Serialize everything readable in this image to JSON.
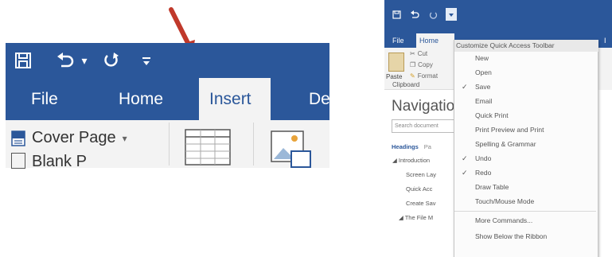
{
  "left": {
    "qat": {
      "save_icon": "save-icon",
      "undo_icon": "undo-icon",
      "undo_dropdown": "▾",
      "redo_icon": "redo-icon",
      "customize_icon": "customize-qat-icon"
    },
    "tabs": [
      "File",
      "Home",
      "Insert",
      "De"
    ],
    "active_tab": "Insert",
    "cover_page": "Cover Page",
    "cover_page_arrow": "▾",
    "blank_page_partial": "Blank P"
  },
  "right": {
    "tabs": [
      "File",
      "Home",
      "I"
    ],
    "ribbon": {
      "paste": "Paste",
      "cut": "Cut",
      "copy": "Copy",
      "format": "Format",
      "clipboard": "Clipboard"
    },
    "navigation": {
      "title": "Navigation",
      "search_placeholder": "Search document",
      "tabs": [
        "Headings",
        "Pa"
      ],
      "headings": [
        "Introduction",
        "Screen Lay",
        "Quick Acc",
        "Create Sav",
        "The File M"
      ]
    },
    "dropdown": {
      "title": "Customize Quick Access Toolbar",
      "items": [
        {
          "label": "New",
          "checked": false
        },
        {
          "label": "Open",
          "checked": false
        },
        {
          "label": "Save",
          "checked": true
        },
        {
          "label": "Email",
          "checked": false
        },
        {
          "label": "Quick Print",
          "checked": false
        },
        {
          "label": "Print Preview and Print",
          "checked": false
        },
        {
          "label": "Spelling & Grammar",
          "checked": false
        },
        {
          "label": "Undo",
          "checked": true
        },
        {
          "label": "Redo",
          "checked": true
        },
        {
          "label": "Draw Table",
          "checked": false
        },
        {
          "label": "Touch/Mouse Mode",
          "checked": false
        },
        {
          "label": "More Commands...",
          "checked": false
        },
        {
          "label": "Show Below the Ribbon",
          "checked": false
        }
      ],
      "check_glyph": "✓"
    }
  },
  "colors": {
    "word_blue": "#2b579a",
    "ribbon_bg": "#f3f3f3",
    "arrow_red": "#c0392b"
  }
}
